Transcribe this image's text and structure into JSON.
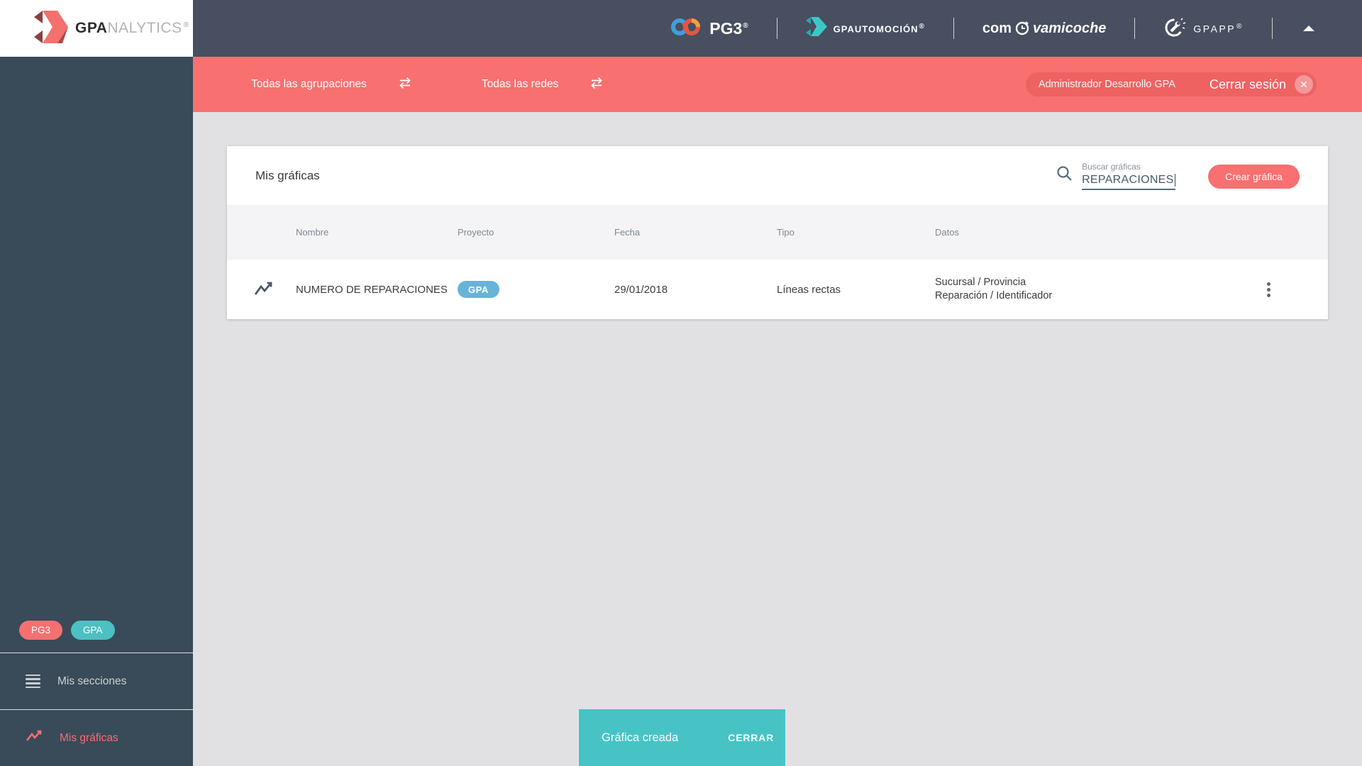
{
  "brand": {
    "logo_bold": "GPA",
    "logo_light": "NALYTICS",
    "registered": "®"
  },
  "header": {
    "pg3_label": "PG3",
    "gpautomocion_label": "GPAUTOMOCIÓN",
    "comprova_prefix": "com",
    "comprova_suffix": "vamicoche",
    "gpapp_label": "GPAPP",
    "registered": "®"
  },
  "filter_bar": {
    "groupings_label": "Todas las agrupaciones",
    "networks_label": "Todas las redes",
    "user_name": "Administrador Desarrollo GPA",
    "logout_label": "Cerrar sesión",
    "logout_icon": "✕"
  },
  "sidebar": {
    "badges": [
      {
        "label": "PG3",
        "color": "#f57070"
      },
      {
        "label": "GPA",
        "color": "#4cc0c2"
      }
    ],
    "items": [
      {
        "label": "Mis secciones",
        "active": false
      },
      {
        "label": "Mis gráficas",
        "active": true
      }
    ]
  },
  "content": {
    "title": "Mis gráficas",
    "search": {
      "label": "Buscar gráficas",
      "value": "REPARACIONES"
    },
    "create_button": "Crear gráfica",
    "table": {
      "columns": [
        "Nombre",
        "Proyecto",
        "Fecha",
        "Tipo",
        "Datos"
      ],
      "rows": [
        {
          "nombre": "NUMERO DE REPARACIONES",
          "proyecto": "GPA",
          "fecha": "29/01/2018",
          "tipo": "Líneas rectas",
          "datos_line1": "Sucursal / Provincia",
          "datos_line2": "Reparación / Identificador"
        }
      ]
    }
  },
  "snackbar": {
    "message": "Gráfica creada",
    "action": "CERRAR"
  },
  "colors": {
    "header_bg": "#474f60",
    "sidebar_bg": "#394a59",
    "accent_red": "#f87070",
    "accent_teal": "#47c3c6",
    "badge_blue": "#68b3d8",
    "badge_teal": "#4cc0c2",
    "main_bg": "#e1e1e4",
    "table_head_bg": "#f4f4f6"
  }
}
